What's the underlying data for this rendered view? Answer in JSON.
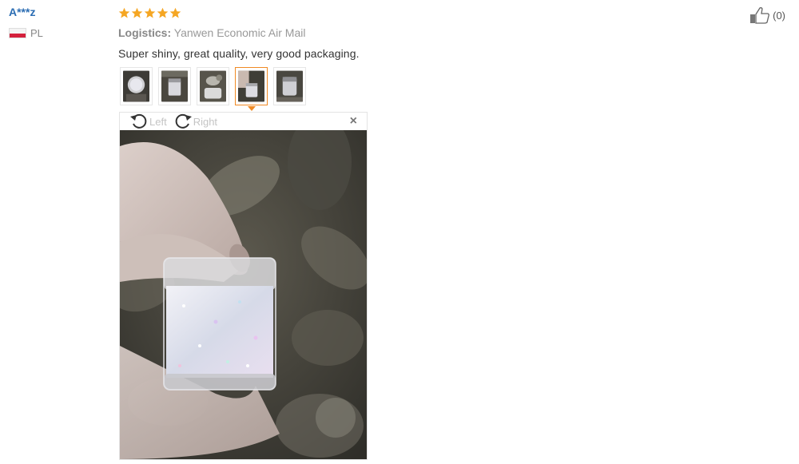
{
  "user": {
    "name": "A***z",
    "country": "PL"
  },
  "review": {
    "rating": 5,
    "logistics_label": "Logistics:",
    "logistics_value": "Yanwen Economic Air Mail",
    "feedback": "Super shiny, great quality, very good packaging."
  },
  "thumbnails": {
    "count": 5,
    "active_index": 3
  },
  "viewer": {
    "rotate_left": "Left",
    "rotate_right": "Right",
    "close": "×"
  },
  "helpful": {
    "count": "(0)"
  },
  "colors": {
    "star": "#f5a623",
    "user_link": "#2b6db3",
    "active_border": "#f08a24"
  }
}
